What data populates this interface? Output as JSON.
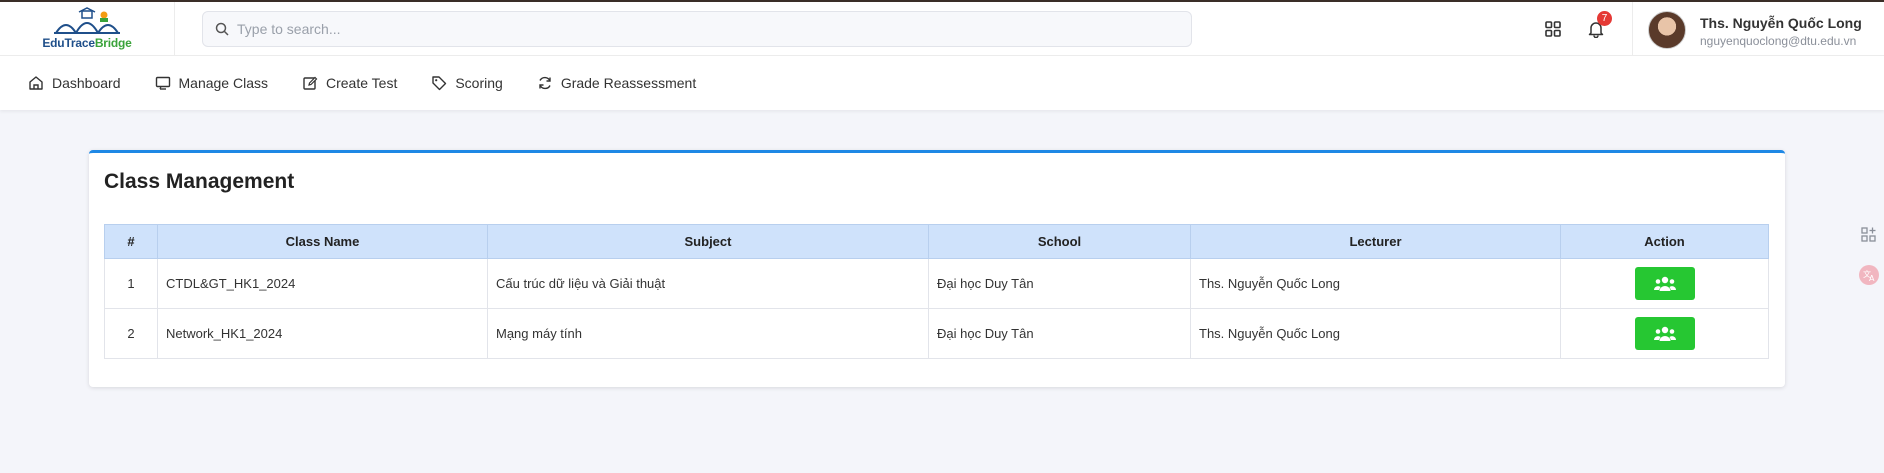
{
  "app": {
    "logo_part1": "EduTrace",
    "logo_part2": "Bridge"
  },
  "search": {
    "placeholder": "Type to search..."
  },
  "header": {
    "notification_count": "7",
    "user_name": "Ths. Nguyễn Quốc Long",
    "user_email": "nguyenquoclong@dtu.edu.vn"
  },
  "nav": {
    "items": [
      {
        "label": "Dashboard",
        "icon": "home-icon"
      },
      {
        "label": "Manage Class",
        "icon": "monitor-icon"
      },
      {
        "label": "Create Test",
        "icon": "edit-icon"
      },
      {
        "label": "Scoring",
        "icon": "tag-icon"
      },
      {
        "label": "Grade Reassessment",
        "icon": "refresh-icon"
      }
    ]
  },
  "page": {
    "title": "Class Management"
  },
  "table": {
    "headers": [
      "#",
      "Class Name",
      "Subject",
      "School",
      "Lecturer",
      "Action"
    ],
    "rows": [
      {
        "num": "1",
        "class_name": "CTDL&GT_HK1_2024",
        "subject": "Cấu trúc dữ liệu và Giải thuật",
        "school": "Đại học Duy Tân",
        "lecturer": "Ths. Nguyễn Quốc Long"
      },
      {
        "num": "2",
        "class_name": "Network_HK1_2024",
        "subject": "Mạng máy tính",
        "school": "Đại học Duy Tân",
        "lecturer": "Ths. Nguyễn Quốc Long"
      }
    ]
  },
  "colors": {
    "accent": "#1e88e5",
    "action_button": "#26c732",
    "table_header": "#cfe2fb",
    "badge": "#e53935"
  }
}
